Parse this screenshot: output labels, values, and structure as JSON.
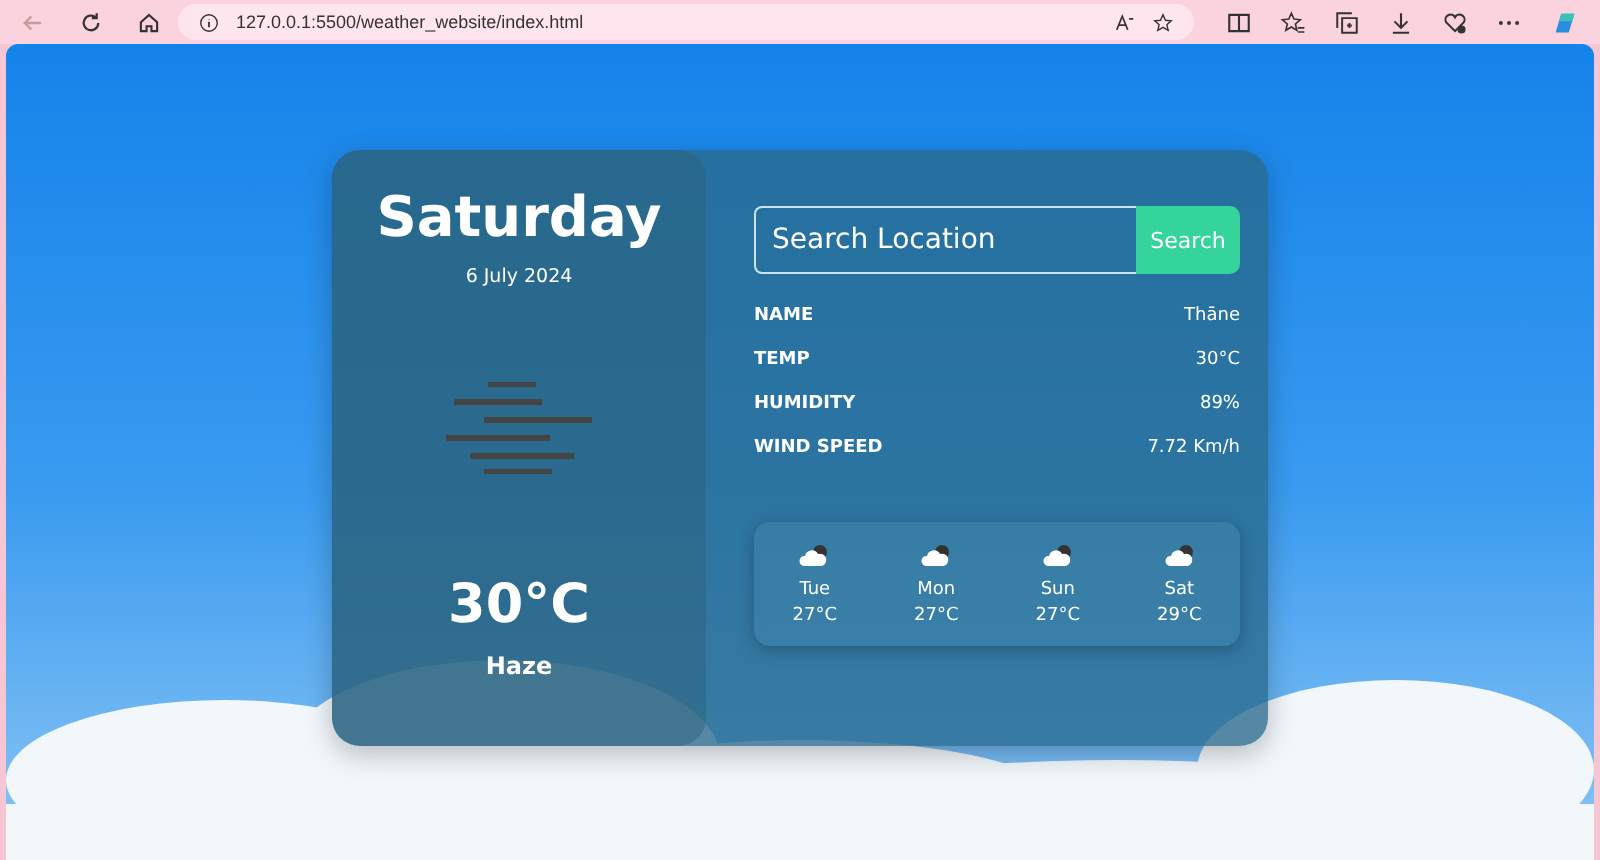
{
  "browser": {
    "address": "127.0.0.1:5500/weather_website/index.html"
  },
  "today": {
    "day": "Saturday",
    "date": "6 July 2024",
    "temperature": "30°C",
    "condition": "Haze"
  },
  "search": {
    "placeholder": "Search Location",
    "button": "Search"
  },
  "details": [
    {
      "label": "NAME",
      "value": "Thāne"
    },
    {
      "label": "TEMP",
      "value": "30°C"
    },
    {
      "label": "HUMIDITY",
      "value": "89%"
    },
    {
      "label": "WIND SPEED",
      "value": "7.72 Km/h"
    }
  ],
  "forecast": [
    {
      "day": "Tue",
      "temperature": "27°C"
    },
    {
      "day": "Mon",
      "temperature": "27°C"
    },
    {
      "day": "Sun",
      "temperature": "27°C"
    },
    {
      "day": "Sat",
      "temperature": "29°C"
    }
  ]
}
